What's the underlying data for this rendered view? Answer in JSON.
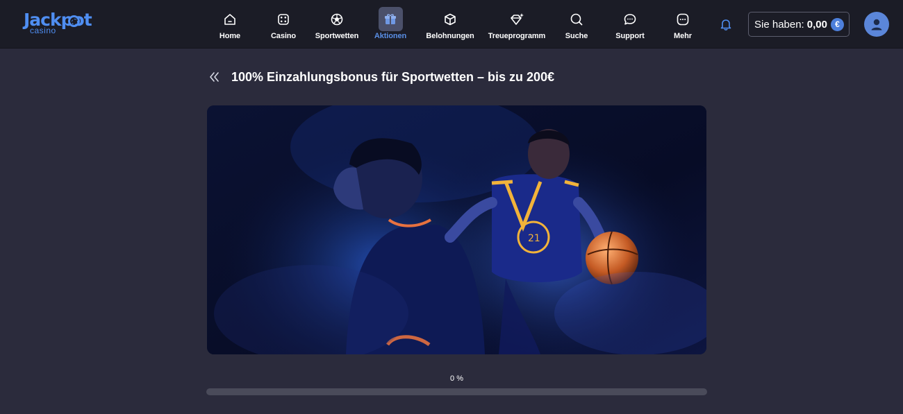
{
  "brand": {
    "name": "Jackpot",
    "sub": "casino",
    "color": "#4f8ef2"
  },
  "nav": {
    "items": [
      {
        "label": "Home",
        "icon": "home-icon"
      },
      {
        "label": "Casino",
        "icon": "dice-icon"
      },
      {
        "label": "Sportwetten",
        "icon": "football-icon"
      },
      {
        "label": "Aktionen",
        "icon": "gift-icon",
        "active": true
      },
      {
        "label": "Belohnungen",
        "icon": "box-icon"
      },
      {
        "label": "Treueprogramm",
        "icon": "diamond-icon"
      },
      {
        "label": "Suche",
        "icon": "search-icon"
      },
      {
        "label": "Support",
        "icon": "chat-icon"
      },
      {
        "label": "Mehr",
        "icon": "more-icon"
      }
    ],
    "active_color": "#5a8fe6"
  },
  "account": {
    "balance_label": "Sie haben:",
    "balance_amount": "0,00",
    "currency_symbol": "€"
  },
  "page": {
    "title": "100% Einzahlungsbonus für Sportwetten – bis zu 200€"
  },
  "progress": {
    "label": "0 %",
    "value_percent": 0
  },
  "colors": {
    "background": "#2b2b3c",
    "header": "#1b1c26",
    "accent": "#4f8ef2"
  }
}
